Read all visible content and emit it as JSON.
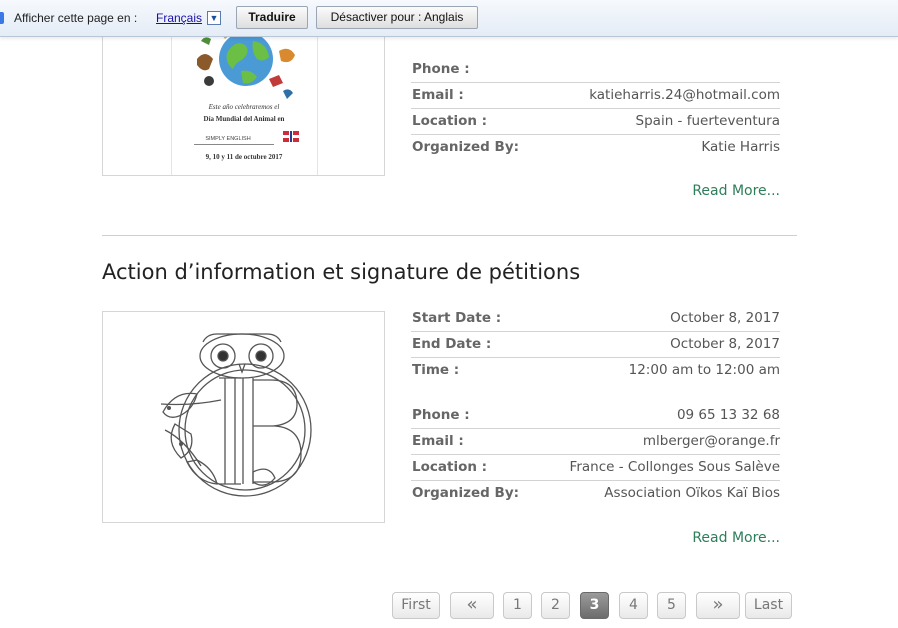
{
  "translate_bar": {
    "prompt": "Afficher cette page en :",
    "language": "Français",
    "dropdown_glyph": "▼",
    "translate_button": "Traduire",
    "disable_button": "Désactiver pour : Anglais"
  },
  "event1": {
    "poster_lines": [
      "Este año celebraremos el",
      "Día Mundial del Animal en",
      "SIMPLY ENGLISH",
      "9, 10 y 11 de octubre 2017"
    ],
    "details": [
      {
        "label": "Phone :",
        "value": ""
      },
      {
        "label": "Email :",
        "value": "katieharris.24@hotmail.com"
      },
      {
        "label": "Location :",
        "value": "Spain - fuerteventura"
      },
      {
        "label": "Organized By:",
        "value": "Katie Harris"
      }
    ],
    "read_more": "Read More..."
  },
  "event2": {
    "title": "Action d’information et signature de pétitions",
    "details": [
      {
        "label": "Start Date :",
        "value": "October 8, 2017"
      },
      {
        "label": "End Date :",
        "value": "October 8, 2017"
      },
      {
        "label": "Time :",
        "value": "12:00 am to 12:00 am"
      },
      {
        "label": "Phone :",
        "value": "09 65 13 32 68"
      },
      {
        "label": "Email :",
        "value": "mlberger@orange.fr"
      },
      {
        "label": "Location :",
        "value": "France - Collonges Sous Salève"
      },
      {
        "label": "Organized By:",
        "value": "Association Oïkos Kaï Bios"
      }
    ],
    "read_more": "Read More..."
  },
  "pagination": {
    "first": "First",
    "prev": "«",
    "pages": [
      "1",
      "2",
      "3",
      "4",
      "5"
    ],
    "current": "3",
    "next": "»",
    "last": "Last"
  },
  "colors": {
    "link_green": "#2e7d5b",
    "translate_link": "#1a0dab",
    "active_page": "#7a7a7a"
  }
}
